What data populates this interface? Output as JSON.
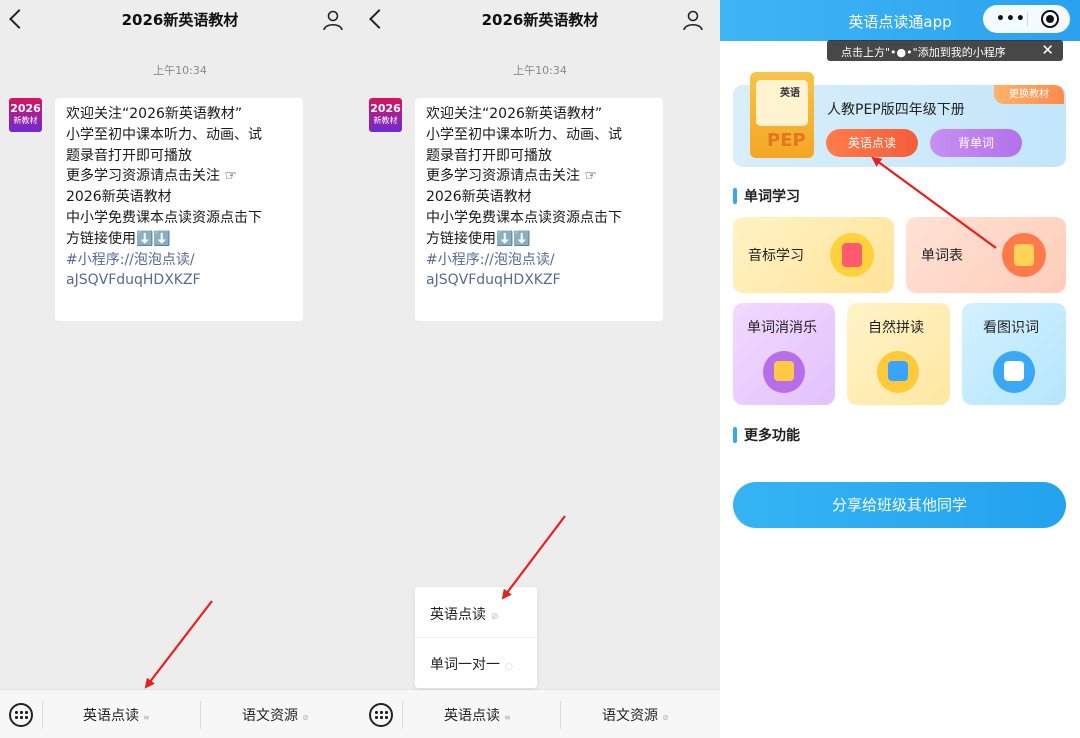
{
  "chat": {
    "title": "2026新英语教材",
    "timestamp": "上午10:34",
    "avatar_line1": "2026",
    "avatar_line2": "新教材",
    "message_lines": [
      "欢迎关注“2026新英语教材”",
      "小学至初中课本听力、动画、试",
      "题录音打开即可播放",
      "更多学习资源请点击关注 ☞",
      "2026新英语教材",
      "中小学免费课本点读资源点击下",
      "方链接使用⬇️⬇️"
    ],
    "link_lines": [
      "#小程序://泡泡点读/",
      "aJSQVFduqHDXKZF"
    ],
    "menu_left": "英语点读",
    "menu_right": "语文资源",
    "menu_left_marker": "≡",
    "menu_right_marker": "⊘",
    "popup_items": [
      {
        "label": "英语点读",
        "marker": "⊘"
      },
      {
        "label": "单词一对一",
        "marker": "◌"
      }
    ]
  },
  "mini": {
    "title": "英语点读通app",
    "capsule_dots": "•••",
    "tip": "点击上方\"•●•\"添加到我的小程序",
    "tip_close": "✕",
    "book_en": "英语",
    "book_pep": "PEP",
    "book_title": "人教PEP版四年级下册",
    "switch_label": "更换教材",
    "btn_read": "英语点读",
    "btn_words": "背单词",
    "section_words": "单词学习",
    "section_more": "更多功能",
    "tiles": [
      {
        "label": "音标学习"
      },
      {
        "label": "单词表"
      },
      {
        "label": "单词消消乐"
      },
      {
        "label": "自然拼读"
      },
      {
        "label": "看图识词"
      }
    ],
    "share_label": "分享给班级其他同学"
  },
  "colors": {
    "accent_blue": "#2aa2ef",
    "arrow_red": "#e8201c",
    "link_blue": "#576b95"
  }
}
